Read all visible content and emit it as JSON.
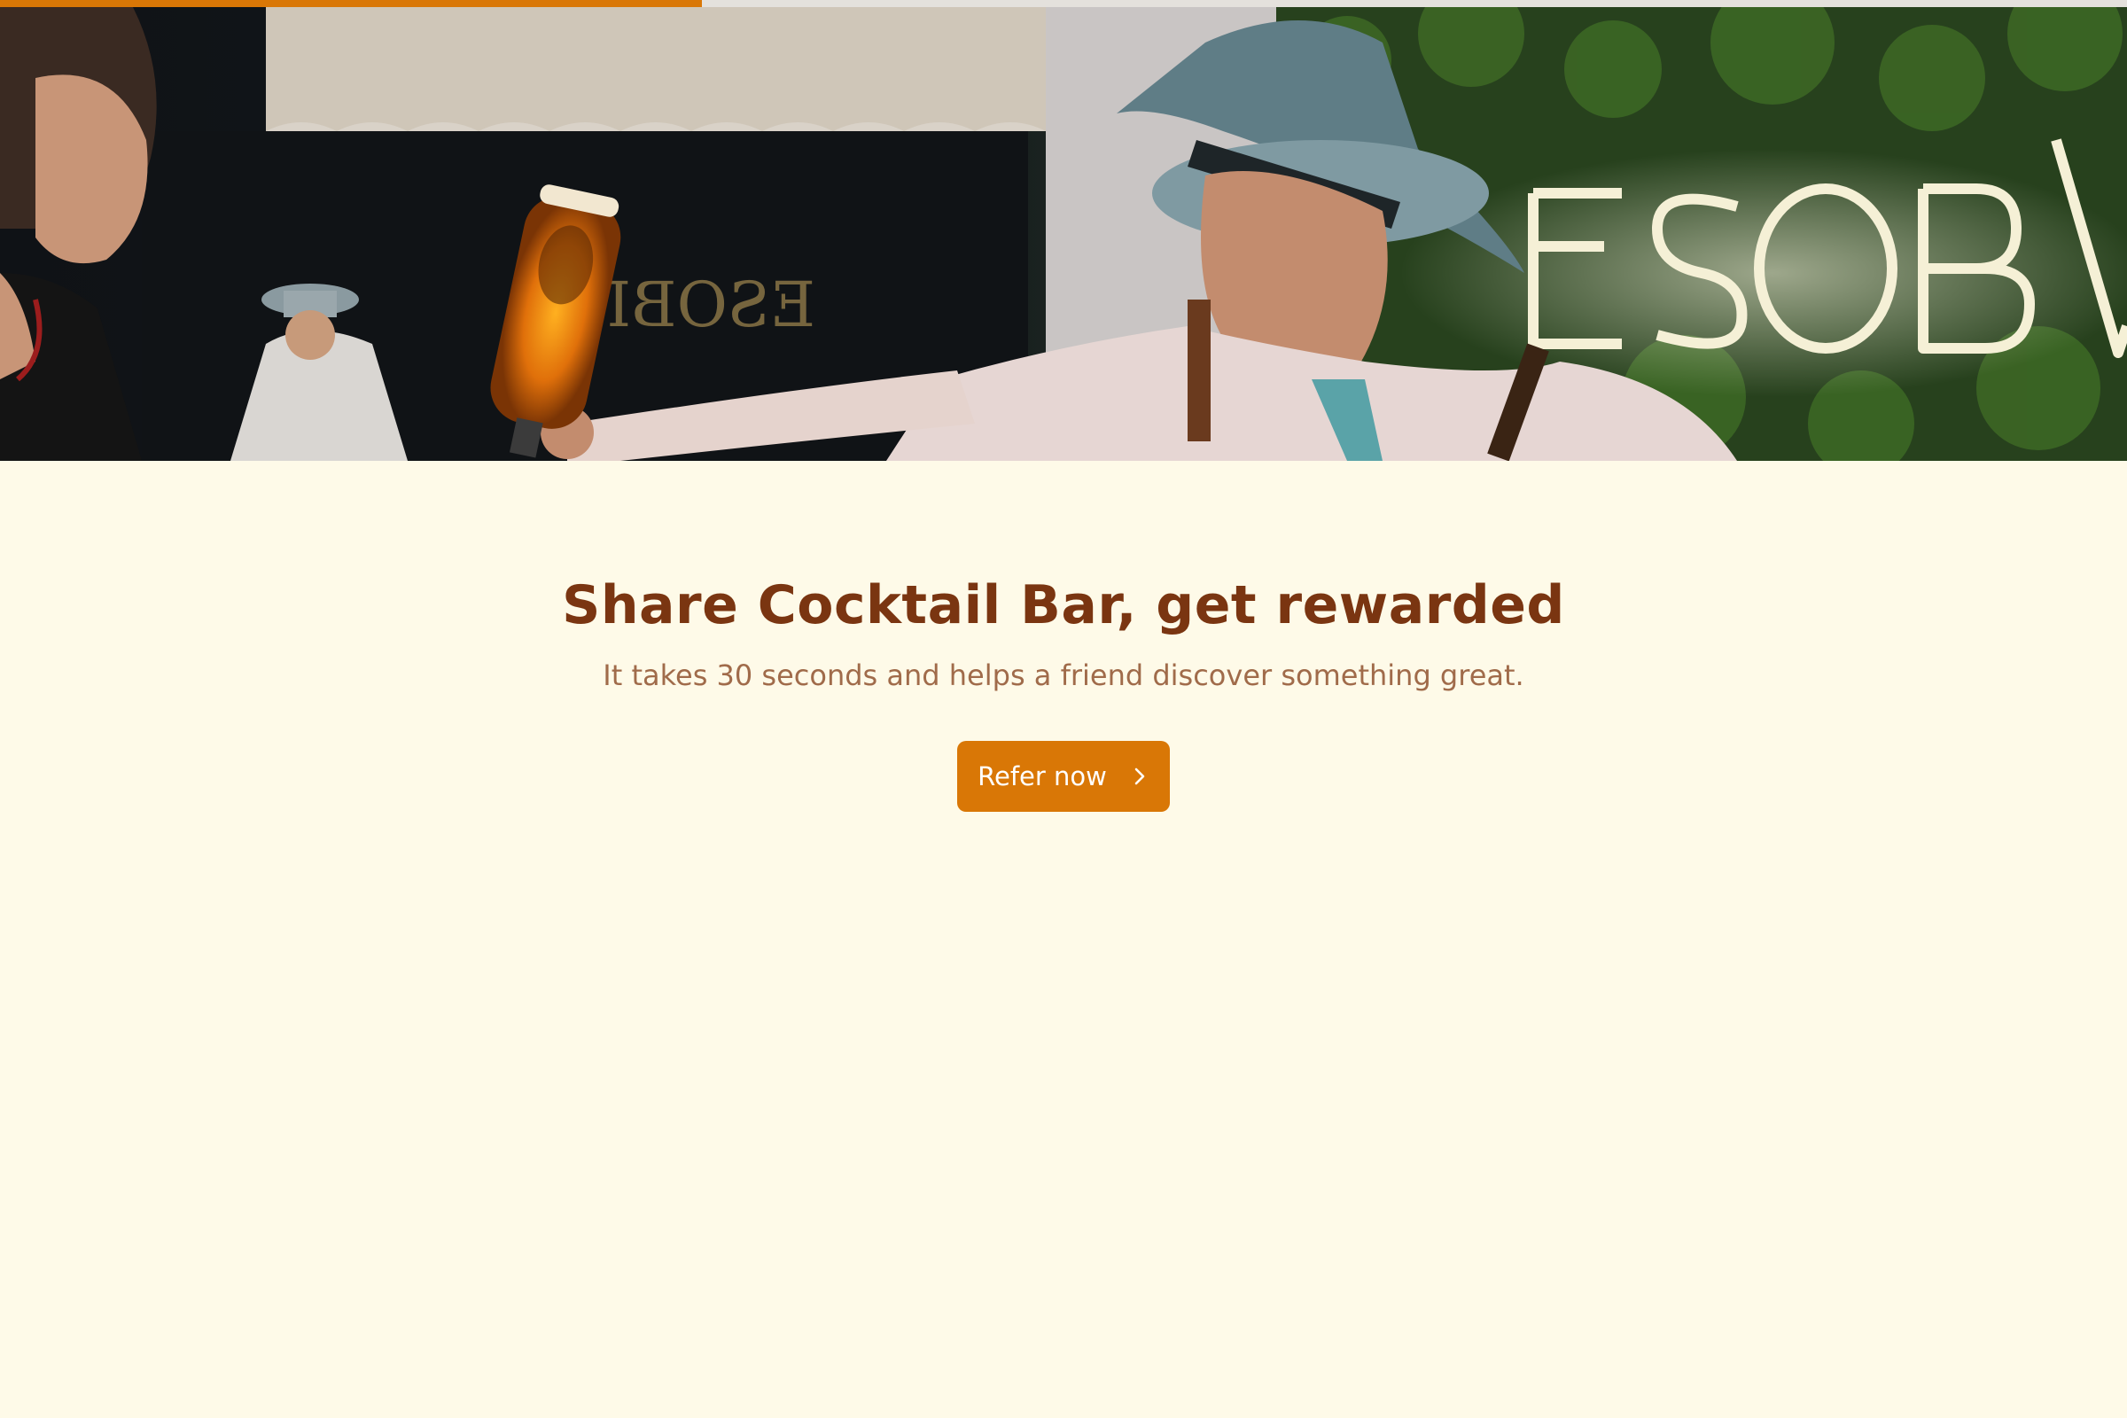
{
  "progress": {
    "fraction": 0.33
  },
  "hero": {
    "image": "bartender pouring a bottle at a cocktail bar with a neon sign on a plant wall"
  },
  "referral": {
    "headline": "Share Cocktail Bar, get rewarded",
    "subtitle": "It takes 30 seconds and helps a friend discover something great.",
    "cta_label": "Refer now",
    "cta_icon": "chevron-right-icon"
  },
  "colors": {
    "accent": "#d97706",
    "headline": "#7a3511",
    "subtitle": "#a06b4a",
    "background": "#fefae8",
    "progress_track": "#e4e1dc"
  }
}
